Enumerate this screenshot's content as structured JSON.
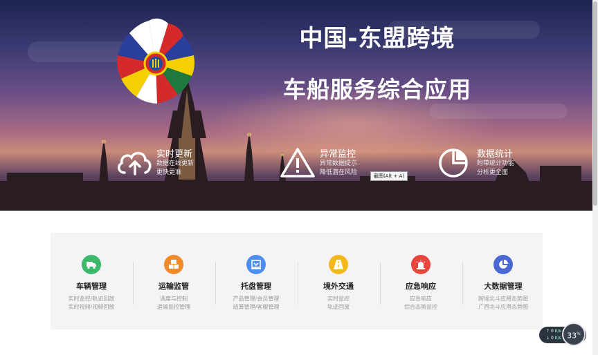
{
  "hero": {
    "title_line1": "中国-东盟跨境",
    "title_line2": "车船服务综合应用",
    "features": [
      {
        "title": "实时更新",
        "desc1": "数据在线更新",
        "desc2": "更快更准",
        "icon": "cloud-upload-icon"
      },
      {
        "title": "异常监控",
        "desc1": "异常数据提示",
        "desc2": "降低潜在风险",
        "icon": "warning-icon"
      },
      {
        "title": "数据统计",
        "desc1": "附带统计功能",
        "desc2": "分析更全面",
        "icon": "pie-chart-icon"
      }
    ],
    "tooltip": "截图(Alt + A)"
  },
  "modules": [
    {
      "title": "车辆管理",
      "desc1": "实时监控/轨迹回放",
      "desc2": "实时视频/视频回放",
      "color": "#3bb86a",
      "icon": "truck-icon"
    },
    {
      "title": "运输监管",
      "desc1": "调度与控制",
      "desc2": "运输监控管理",
      "color": "#f28a2a",
      "icon": "boxes-icon"
    },
    {
      "title": "托盘管理",
      "desc1": "产品管理/会员管理",
      "desc2": "结算管理/客服管理",
      "color": "#4c8ef0",
      "icon": "pallet-icon"
    },
    {
      "title": "境外交通",
      "desc1": "实时监控",
      "desc2": "轨迹回放",
      "color": "#f5b81c",
      "icon": "road-icon"
    },
    {
      "title": "应急响应",
      "desc1": "应急响应",
      "desc2": "综合态势监控",
      "color": "#e8453c",
      "icon": "alarm-icon"
    },
    {
      "title": "大数据管理",
      "desc1": "跨境北斗应用态势图",
      "desc2": "广西北斗应用态势图",
      "color": "#4a67d6",
      "icon": "pie-chart-icon"
    }
  ],
  "widget": {
    "up": "0",
    "up_unit": "K/s",
    "down": "0",
    "down_unit": "K/s",
    "percent": "33",
    "percent_unit": "%"
  }
}
